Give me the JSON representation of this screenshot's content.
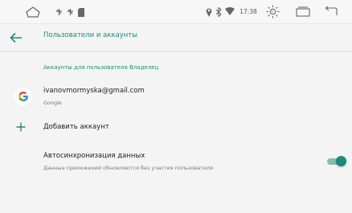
{
  "status_bar": {
    "time": "17:38",
    "icons": [
      "home-outline-icon",
      "notification-icon",
      "notification-icon",
      "sd-card-icon",
      "location-icon",
      "bluetooth-icon",
      "wifi-icon",
      "brightness-icon",
      "recent-apps-icon",
      "back-nav-icon"
    ]
  },
  "toolbar": {
    "title": "Пользователи и аккаунты",
    "back_icon": "arrow-left-icon"
  },
  "section": {
    "header": "Аккаунты для пользователя Владелец"
  },
  "account": {
    "email": "ivanovmormyska@gmail.com",
    "provider": "Google",
    "icon": "google-icon"
  },
  "add_account": {
    "label": "Добавить аккаунт",
    "icon": "plus-icon"
  },
  "auto_sync": {
    "title": "Автосинхронизация данных",
    "summary": "Данные приложений обновляются без участия пользователя",
    "enabled": true
  },
  "colors": {
    "accent": "#1c8a7a",
    "background": "#f4f4f4"
  }
}
